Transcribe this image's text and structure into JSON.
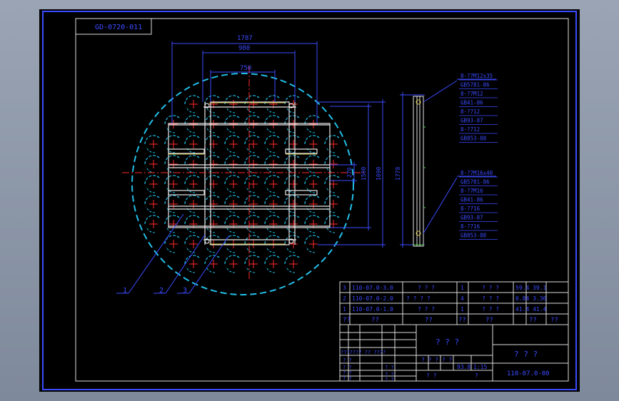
{
  "drawing": {
    "doc_code": "GD-0720-011",
    "dims": {
      "overall_width": "1787",
      "mid_width": "980",
      "inner_width": "750",
      "vert_small": "270",
      "vert_mid": "1500",
      "vert_large": "1690",
      "side_height": "1778"
    },
    "parts": [
      {
        "no": "1",
        "code": "1"
      },
      {
        "no": "2",
        "code": "2"
      },
      {
        "no": "3",
        "code": "3"
      }
    ],
    "callouts_top": [
      "8-?7M12x35",
      "GB5781-86",
      "8-?7M12",
      "GB41-86",
      "8-?712",
      "GB93-87",
      "8-?712",
      "GB853-88"
    ],
    "callouts_bottom": [
      "8-?7M16x40",
      "GB5781-86",
      "8-?7M16",
      "GB41-86",
      "8-?716",
      "GB93-87",
      "8-?716",
      "GB853-88"
    ]
  },
  "bom": {
    "rows": [
      {
        "no": "3",
        "code": "110-07.0-3.0",
        "name": "? ? ?",
        "qty": "1",
        "mat": "? ? ?",
        "note": "59.4 39.1"
      },
      {
        "no": "2",
        "code": "110-07.0-2.0",
        "name": "? ? ? ?",
        "qty": "4",
        "mat": "? ? ?",
        "note": "0.84 3.36"
      },
      {
        "no": "1",
        "code": "110-07.0-1.0",
        "name": "? ? ?",
        "qty": "1",
        "mat": "? ? ?",
        "note": "41.4 41.4"
      }
    ],
    "header": {
      "no": "??",
      "code": "??",
      "name": "??",
      "qty": "??",
      "mat": "??",
      "w1": "??",
      "note": "??"
    }
  },
  "title_block": {
    "company": "? ? ?",
    "drawing_title": "? ? ?",
    "drawing_no": "110-07.0-00",
    "scale": "1:15",
    "weight": "93.8",
    "stage_labels": [
      "? ? ? ? ?",
      "? ?",
      "? ?"
    ],
    "left_labels": [
      "? ?",
      "? ?",
      "? ?",
      "? ?",
      "? ?"
    ],
    "sign_row": "??????? ?? ????",
    "page_label": "? ?",
    "sheet_label": "?"
  }
}
